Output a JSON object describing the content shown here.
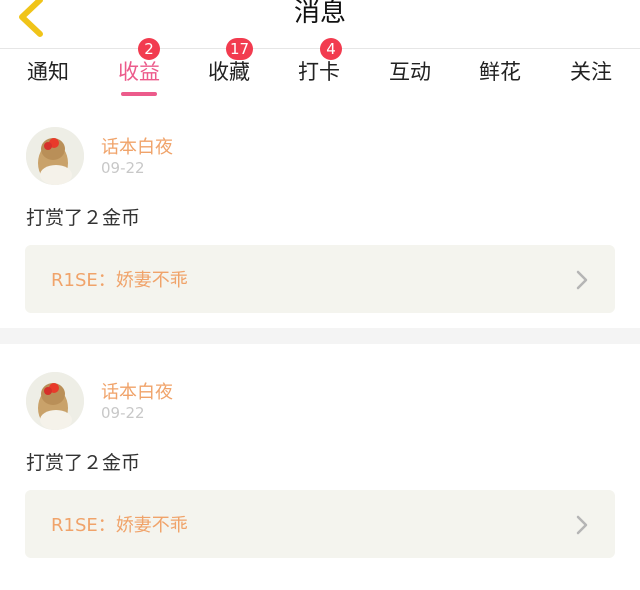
{
  "header": {
    "title": "消息",
    "back_icon": "chevron-left-icon",
    "back_color": "#f0c419"
  },
  "tabs": [
    {
      "label": "通知",
      "badge": null,
      "active": false
    },
    {
      "label": "收益",
      "badge": "2",
      "active": true
    },
    {
      "label": "收藏",
      "badge": "17",
      "active": false
    },
    {
      "label": "打卡",
      "badge": "4",
      "active": false
    },
    {
      "label": "互动",
      "badge": null,
      "active": false
    },
    {
      "label": "鲜花",
      "badge": null,
      "active": false
    },
    {
      "label": "关注",
      "badge": null,
      "active": false
    }
  ],
  "messages": [
    {
      "user": "话本白夜",
      "date": "09-22",
      "text": "打赏了２金币",
      "link": "R1SE：娇妻不乖",
      "chevron_icon": "chevron-right-icon"
    },
    {
      "user": "话本白夜",
      "date": "09-22",
      "text": "打赏了２金币",
      "link": "R1SE：娇妻不乖",
      "chevron_icon": "chevron-right-icon"
    }
  ],
  "colors": {
    "accent": "#ec5b8b",
    "badge": "#f23b4f",
    "username": "#f0a36a",
    "link_bg": "#f4f4ee"
  }
}
